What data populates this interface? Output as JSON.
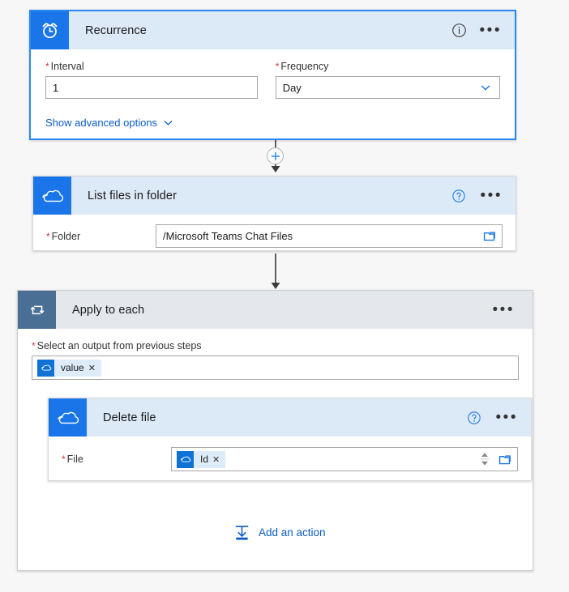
{
  "flow": {
    "trigger": {
      "title": "Recurrence",
      "icon": "alarm-clock-icon",
      "info_icon": "info-icon",
      "more_icon": "more-options-icon",
      "accent": "#1a76e8",
      "header_bg": "#dce9f7",
      "selected_border": "#2b88f0",
      "fields": {
        "interval_label": "Interval",
        "interval_value": "1",
        "frequency_label": "Frequency",
        "frequency_value": "Day"
      },
      "advanced_link": "Show advanced options"
    },
    "list_files": {
      "title": "List files in folder",
      "icon": "onedrive-cloud-icon",
      "help_icon": "help-icon",
      "more_icon": "more-options-icon",
      "accent": "#0f72d4",
      "header_bg": "#dce9f7",
      "fields": {
        "folder_label": "Folder",
        "folder_value": "/Microsoft Teams Chat Files",
        "folder_picker_icon": "folder-picker-icon"
      }
    },
    "apply_to_each": {
      "title": "Apply to each",
      "icon": "loop-foreach-icon",
      "more_icon": "more-options-icon",
      "accent": "#4a6f95",
      "header_bg": "#e4e8ed",
      "fields": {
        "output_label": "Select an output from previous steps",
        "output_token": "value",
        "output_token_icon": "onedrive-cloud-icon",
        "token_remove_icon": "remove-token-icon"
      },
      "add_action_label": "Add an action",
      "add_action_icon": "add-action-icon"
    },
    "delete_file": {
      "title": "Delete file",
      "icon": "onedrive-cloud-icon",
      "help_icon": "help-icon",
      "more_icon": "more-options-icon",
      "accent": "#0f72d4",
      "header_bg": "#dce9f7",
      "fields": {
        "file_label": "File",
        "file_token": "Id",
        "file_token_icon": "onedrive-cloud-icon",
        "token_remove_icon": "remove-token-icon",
        "spinner_icon": "spinner-updown-icon",
        "folder_picker_icon": "folder-picker-icon"
      }
    },
    "connectors": {
      "insert_icon": "insert-step-plus-icon",
      "arrow_icon": "arrow-down-icon"
    }
  }
}
